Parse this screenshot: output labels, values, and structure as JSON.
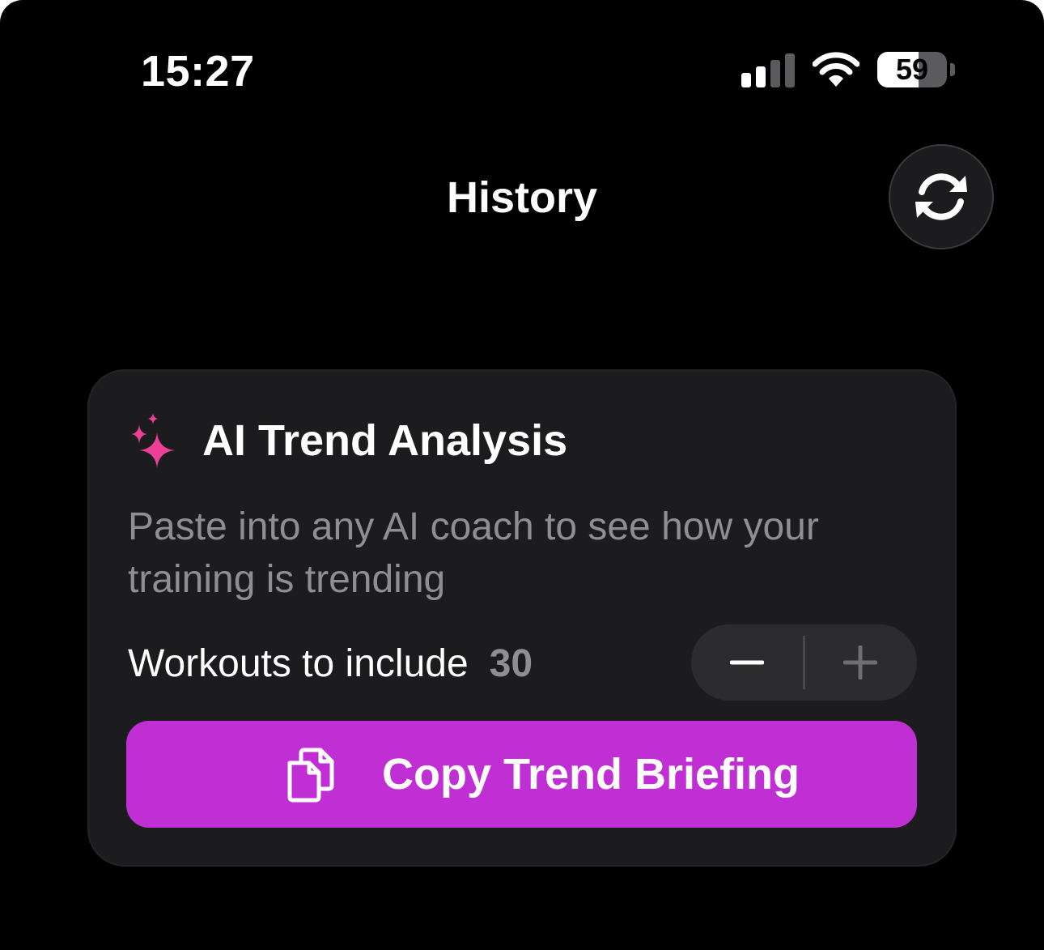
{
  "status_bar": {
    "time": "15:27",
    "battery_level": "59",
    "battery_fraction": 0.59,
    "signal_bars_active": 2,
    "signal_bars_total": 4
  },
  "nav": {
    "title": "History",
    "refresh_icon": "refresh-icon"
  },
  "card": {
    "title": "AI Trend Analysis",
    "icon": "sparkles-icon",
    "subtitle": "Paste into any AI coach to see how your training is trending",
    "workouts_label": "Workouts to include",
    "workouts_value": "30",
    "stepper": {
      "minus_icon": "minus-icon",
      "plus_icon": "plus-icon"
    },
    "copy_button": {
      "label": "Copy Trend Briefing",
      "icon": "document-copy-icon"
    }
  },
  "colors": {
    "background": "#000000",
    "card": "#1c1c1e",
    "accent_button": "#bf2fd3",
    "sparkle": "#ee3f97",
    "secondary_text": "#8e8e93"
  }
}
